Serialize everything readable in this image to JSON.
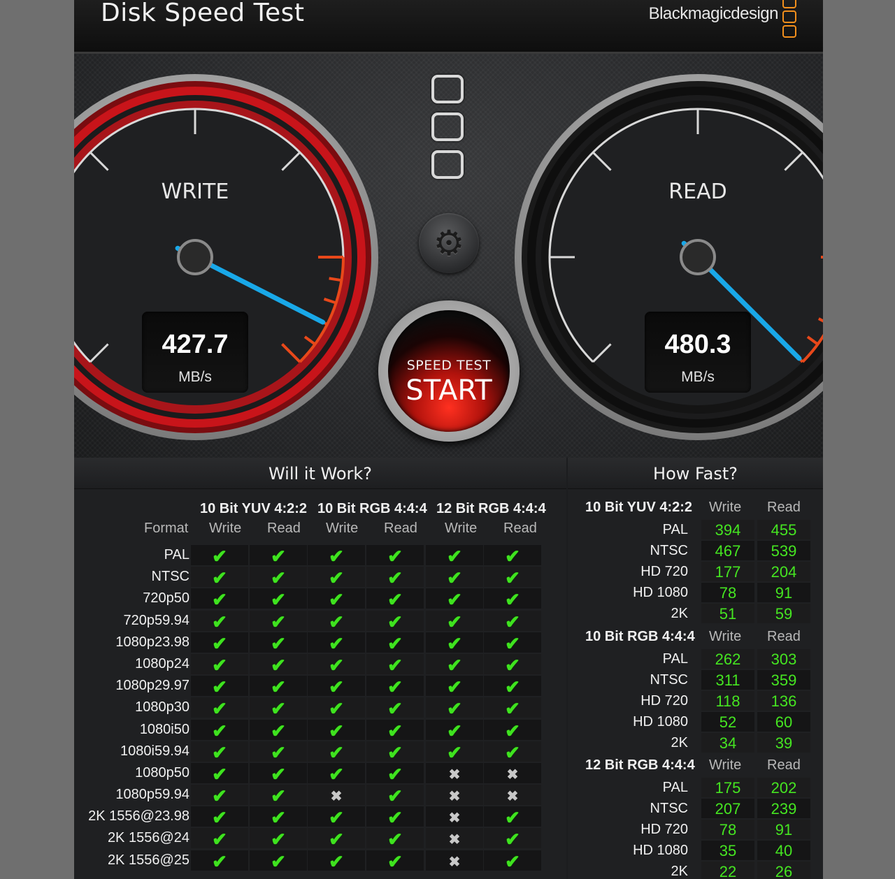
{
  "app": {
    "title": "Disk Speed Test",
    "brand": "Blackmagicdesign"
  },
  "gauges": {
    "write": {
      "label": "WRITE",
      "value": "427.7",
      "unit": "MB/s"
    },
    "read": {
      "label": "READ",
      "value": "480.3",
      "unit": "MB/s"
    }
  },
  "start_button": {
    "small": "SPEED TEST",
    "big": "START"
  },
  "will_it_work": {
    "title": "Will it Work?",
    "format_label": "Format",
    "groups": [
      "10 Bit YUV 4:2:2",
      "10 Bit RGB 4:4:4",
      "12 Bit RGB 4:4:4"
    ],
    "sub_headers": [
      "Write",
      "Read",
      "Write",
      "Read",
      "Write",
      "Read"
    ],
    "rows": [
      {
        "format": "PAL",
        "results": [
          "yes",
          "yes",
          "yes",
          "yes",
          "yes",
          "yes"
        ]
      },
      {
        "format": "NTSC",
        "results": [
          "yes",
          "yes",
          "yes",
          "yes",
          "yes",
          "yes"
        ]
      },
      {
        "format": "720p50",
        "results": [
          "yes",
          "yes",
          "yes",
          "yes",
          "yes",
          "yes"
        ]
      },
      {
        "format": "720p59.94",
        "results": [
          "yes",
          "yes",
          "yes",
          "yes",
          "yes",
          "yes"
        ]
      },
      {
        "format": "1080p23.98",
        "results": [
          "yes",
          "yes",
          "yes",
          "yes",
          "yes",
          "yes"
        ]
      },
      {
        "format": "1080p24",
        "results": [
          "yes",
          "yes",
          "yes",
          "yes",
          "yes",
          "yes"
        ]
      },
      {
        "format": "1080p29.97",
        "results": [
          "yes",
          "yes",
          "yes",
          "yes",
          "yes",
          "yes"
        ]
      },
      {
        "format": "1080p30",
        "results": [
          "yes",
          "yes",
          "yes",
          "yes",
          "yes",
          "yes"
        ]
      },
      {
        "format": "1080i50",
        "results": [
          "yes",
          "yes",
          "yes",
          "yes",
          "yes",
          "yes"
        ]
      },
      {
        "format": "1080i59.94",
        "results": [
          "yes",
          "yes",
          "yes",
          "yes",
          "yes",
          "yes"
        ]
      },
      {
        "format": "1080p50",
        "results": [
          "yes",
          "yes",
          "yes",
          "yes",
          "no",
          "no"
        ]
      },
      {
        "format": "1080p59.94",
        "results": [
          "yes",
          "yes",
          "no",
          "yes",
          "no",
          "no"
        ]
      },
      {
        "format": "2K 1556@23.98",
        "results": [
          "yes",
          "yes",
          "yes",
          "yes",
          "no",
          "yes"
        ]
      },
      {
        "format": "2K 1556@24",
        "results": [
          "yes",
          "yes",
          "yes",
          "yes",
          "no",
          "yes"
        ]
      },
      {
        "format": "2K 1556@25",
        "results": [
          "yes",
          "yes",
          "yes",
          "yes",
          "no",
          "yes"
        ]
      }
    ]
  },
  "how_fast": {
    "title": "How Fast?",
    "sections": [
      {
        "name": "10 Bit YUV 4:2:2",
        "write_label": "Write",
        "read_label": "Read",
        "rows": [
          {
            "format": "PAL",
            "write": "394",
            "read": "455"
          },
          {
            "format": "NTSC",
            "write": "467",
            "read": "539"
          },
          {
            "format": "HD 720",
            "write": "177",
            "read": "204"
          },
          {
            "format": "HD 1080",
            "write": "78",
            "read": "91"
          },
          {
            "format": "2K",
            "write": "51",
            "read": "59"
          }
        ]
      },
      {
        "name": "10 Bit RGB 4:4:4",
        "write_label": "Write",
        "read_label": "Read",
        "rows": [
          {
            "format": "PAL",
            "write": "262",
            "read": "303"
          },
          {
            "format": "NTSC",
            "write": "311",
            "read": "359"
          },
          {
            "format": "HD 720",
            "write": "118",
            "read": "136"
          },
          {
            "format": "HD 1080",
            "write": "52",
            "read": "60"
          },
          {
            "format": "2K",
            "write": "34",
            "read": "39"
          }
        ]
      },
      {
        "name": "12 Bit RGB 4:4:4",
        "write_label": "Write",
        "read_label": "Read",
        "rows": [
          {
            "format": "PAL",
            "write": "175",
            "read": "202"
          },
          {
            "format": "NTSC",
            "write": "207",
            "read": "239"
          },
          {
            "format": "HD 720",
            "write": "78",
            "read": "91"
          },
          {
            "format": "HD 1080",
            "write": "35",
            "read": "40"
          },
          {
            "format": "2K",
            "write": "22",
            "read": "26"
          }
        ]
      }
    ]
  },
  "icons": {
    "settings": "gear-icon",
    "yes": "checkmark-icon",
    "no": "cross-icon"
  },
  "colors": {
    "accent_red": "#c8141a",
    "needle": "#19a8e8",
    "ok_green": "#3fe31f",
    "brand_orange": "#f28f1c"
  }
}
